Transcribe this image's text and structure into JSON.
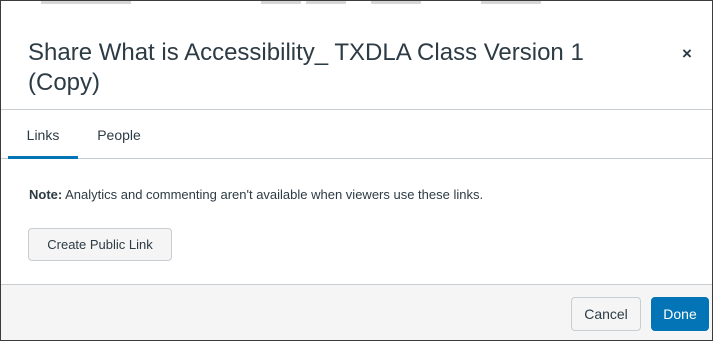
{
  "dialog": {
    "title": "Share What is Accessibility_ TXDLA Class Version 1 (Copy)",
    "close_icon": "close-icon",
    "close_glyph": "×"
  },
  "tabs": [
    {
      "label": "Links",
      "active": true
    },
    {
      "label": "People",
      "active": false
    }
  ],
  "links_panel": {
    "note_label": "Note:",
    "note_text": " Analytics and commenting aren't available when viewers use these links.",
    "create_public_link_label": "Create Public Link"
  },
  "footer": {
    "cancel_label": "Cancel",
    "done_label": "Done"
  },
  "colors": {
    "accent": "#0374b5",
    "text": "#2d3b45",
    "border": "#c7cdd1",
    "footer_bg": "#f5f5f5"
  }
}
